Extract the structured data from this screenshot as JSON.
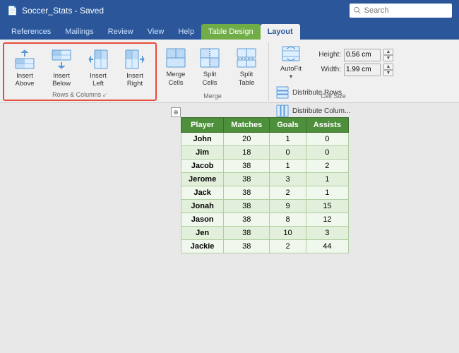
{
  "titleBar": {
    "title": "Soccer_Stats - Saved",
    "saveIcon": "✓",
    "searchPlaceholder": "Search"
  },
  "ribbonTabs": [
    {
      "label": "References",
      "active": false,
      "highlighted": false
    },
    {
      "label": "Mailings",
      "active": false,
      "highlighted": false
    },
    {
      "label": "Review",
      "active": false,
      "highlighted": false
    },
    {
      "label": "View",
      "active": false,
      "highlighted": false
    },
    {
      "label": "Help",
      "active": false,
      "highlighted": false
    },
    {
      "label": "Table Design",
      "active": false,
      "highlighted": true
    },
    {
      "label": "Layout",
      "active": true,
      "highlighted": false
    }
  ],
  "groups": {
    "rowsColumns": {
      "label": "Rows & Columns",
      "buttons": [
        {
          "id": "insert-above",
          "label": "Insert Above"
        },
        {
          "id": "insert-below",
          "label": "Insert Below"
        },
        {
          "id": "insert-left",
          "label": "Insert Left"
        },
        {
          "id": "insert-right",
          "label": "Insert Right"
        }
      ]
    },
    "merge": {
      "label": "Merge",
      "buttons": [
        {
          "id": "merge-cells",
          "label": "Merge Cells"
        },
        {
          "id": "split-cells",
          "label": "Split Cells"
        },
        {
          "id": "split-table",
          "label": "Split Table"
        }
      ]
    },
    "cellSize": {
      "label": "Cell Size",
      "heightLabel": "Height:",
      "widthLabel": "Width:",
      "heightValue": "0.56 cm",
      "widthValue": "1.99 cm",
      "autofit": {
        "id": "autofit",
        "label": "AutoFit"
      },
      "distributeRows": "Distribute Rows",
      "distributeColumns": "Distribute Colum..."
    }
  },
  "table": {
    "headers": [
      "Player",
      "Matches",
      "Goals",
      "Assists"
    ],
    "rows": [
      [
        "John",
        "20",
        "1",
        "0"
      ],
      [
        "Jim",
        "18",
        "0",
        "0"
      ],
      [
        "Jacob",
        "38",
        "1",
        "2"
      ],
      [
        "Jerome",
        "38",
        "3",
        "1"
      ],
      [
        "Jack",
        "38",
        "2",
        "1"
      ],
      [
        "Jonah",
        "38",
        "9",
        "15"
      ],
      [
        "Jason",
        "38",
        "8",
        "12"
      ],
      [
        "Jen",
        "38",
        "10",
        "3"
      ],
      [
        "Jackie",
        "38",
        "2",
        "44"
      ]
    ]
  }
}
